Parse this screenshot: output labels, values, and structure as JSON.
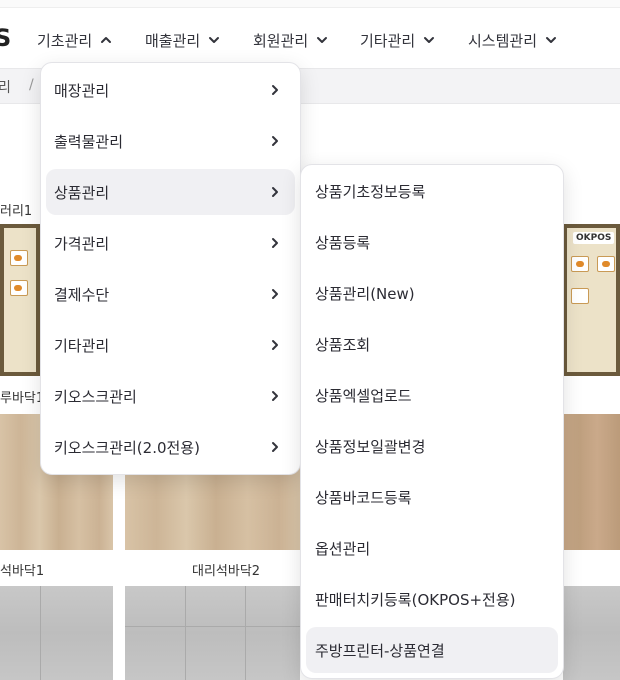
{
  "brand": {
    "fragment": "S"
  },
  "topnav": {
    "items": [
      {
        "label": "기초관리",
        "expanded": true
      },
      {
        "label": "매출관리",
        "expanded": false
      },
      {
        "label": "회원관리",
        "expanded": false
      },
      {
        "label": "기타관리",
        "expanded": false
      },
      {
        "label": "시스템관리",
        "expanded": false
      }
    ]
  },
  "breadcrumb": {
    "current": "리",
    "separator": "/"
  },
  "content": {
    "tiles": [
      {
        "label": "러리1"
      },
      {
        "label": "루바닥1"
      },
      {
        "label": "석바닥1"
      },
      {
        "label": "대리석바닥2"
      }
    ],
    "thumb_badge": "OKPOS"
  },
  "menu": {
    "items": [
      {
        "label": "매장관리"
      },
      {
        "label": "출력물관리"
      },
      {
        "label": "상품관리",
        "active": true
      },
      {
        "label": "가격관리"
      },
      {
        "label": "결제수단"
      },
      {
        "label": "기타관리"
      },
      {
        "label": "키오스크관리"
      },
      {
        "label": "키오스크관리(2.0전용)"
      }
    ],
    "submenu": [
      {
        "label": "상품기초정보등록"
      },
      {
        "label": "상품등록"
      },
      {
        "label": "상품관리(New)"
      },
      {
        "label": "상품조회"
      },
      {
        "label": "상품엑셀업로드"
      },
      {
        "label": "상품정보일괄변경"
      },
      {
        "label": "상품바코드등록"
      },
      {
        "label": "옵션관리"
      },
      {
        "label": "판매터치키등록(OKPOS+전용)"
      },
      {
        "label": "주방프린터-상품연결",
        "hovered": true
      }
    ]
  },
  "colors": {
    "text": "#2b2b33",
    "menu_highlight": "#f0f0f3",
    "breadcrumb_bg": "#f3f3f5"
  }
}
